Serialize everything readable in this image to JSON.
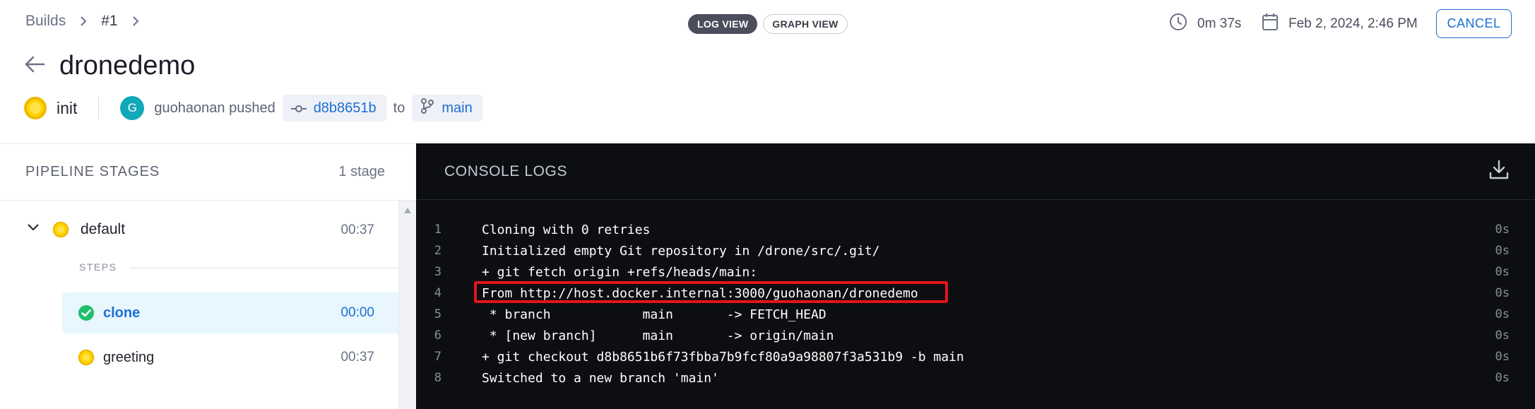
{
  "breadcrumb": {
    "builds": "Builds",
    "build_number": "#1"
  },
  "view_toggle": {
    "log_view": "LOG VIEW",
    "graph_view": "GRAPH VIEW",
    "active": "log"
  },
  "header_meta": {
    "duration": "0m 37s",
    "date": "Feb 2, 2024, 2:46 PM",
    "cancel": "CANCEL"
  },
  "title": "dronedemo",
  "status": {
    "step": "init",
    "avatar_letter": "G",
    "pusher": "guohaonan pushed",
    "commit": "d8b8651b",
    "to": "to",
    "branch": "main"
  },
  "pipeline": {
    "heading": "PIPELINE STAGES",
    "count": "1 stage",
    "stage": {
      "name": "default",
      "time": "00:37"
    },
    "steps_label": "STEPS",
    "steps": [
      {
        "name": "clone",
        "time": "00:00",
        "status": "success",
        "selected": true
      },
      {
        "name": "greeting",
        "time": "00:37",
        "status": "running",
        "selected": false
      }
    ]
  },
  "console": {
    "heading": "CONSOLE LOGS",
    "lines": [
      {
        "n": "1",
        "text": "Cloning with 0 retries",
        "dur": "0s"
      },
      {
        "n": "2",
        "text": "Initialized empty Git repository in /drone/src/.git/",
        "dur": "0s"
      },
      {
        "n": "3",
        "text": "+ git fetch origin +refs/heads/main:",
        "dur": "0s"
      },
      {
        "n": "4",
        "text": "From http://host.docker.internal:3000/guohaonan/dronedemo",
        "dur": "0s"
      },
      {
        "n": "5",
        "text": " * branch            main       -> FETCH_HEAD",
        "dur": "0s"
      },
      {
        "n": "6",
        "text": " * [new branch]      main       -> origin/main",
        "dur": "0s"
      },
      {
        "n": "7",
        "text": "+ git checkout d8b8651b6f73fbba7b9fcf80a9a98807f3a531b9 -b main",
        "dur": "0s"
      },
      {
        "n": "8",
        "text": "Switched to a new branch 'main'",
        "dur": "0s"
      }
    ]
  },
  "colors": {
    "accent": "#1b6fd4",
    "running": "#ffd400",
    "success": "#1fbf6b",
    "highlight": "#e5141b"
  }
}
